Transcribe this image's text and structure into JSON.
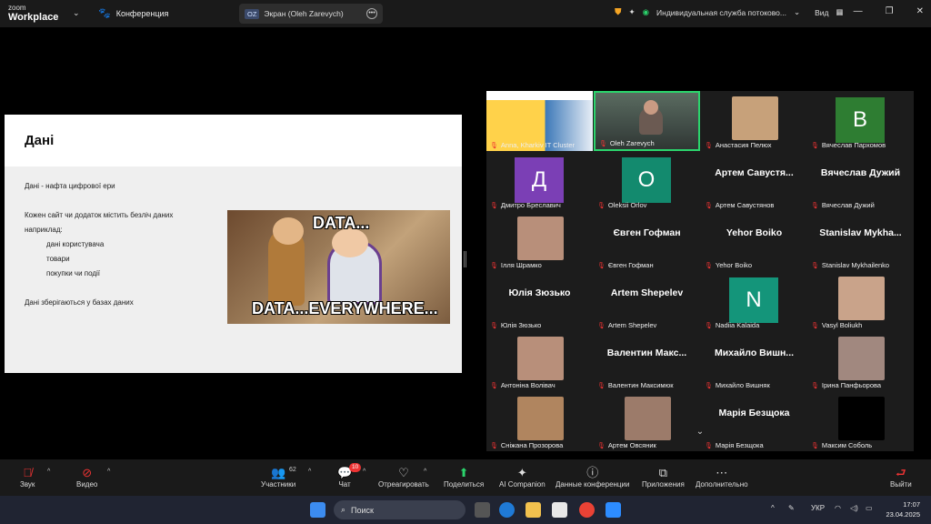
{
  "topbar": {
    "brand_line1": "zoom",
    "brand_line2": "Workplace",
    "meeting_label": "Конференция",
    "share_initials": "OZ",
    "share_label": "Экран (Oleh Zarevych)",
    "service_label": "Индивидуальная служба потоково...",
    "view_label": "Вид"
  },
  "slide": {
    "title": "Дані",
    "line1": "Дані - нафта цифрової ери",
    "line2": "Кожен сайт чи додаток містить безліч даних",
    "line3": "наприклад:",
    "item1": "дані користувача",
    "item2": "товари",
    "item3": "покупки чи події",
    "line4": "Дані зберігаються у базах даних",
    "meme_top": "DATA...",
    "meme_bottom": "DATA...EVERYWHERE..."
  },
  "participants": [
    {
      "name": "Anna, Kharkiv IT Cluster"
    },
    {
      "name": "Oleh Zarevych"
    },
    {
      "name": "Анастасия Пелюх"
    },
    {
      "name": "Вячеслав Пархомов",
      "initial": "В",
      "color": "#2e7d32"
    },
    {
      "name": "Дмитро Бреславич",
      "initial": "Д",
      "color": "#7b3fb5"
    },
    {
      "name": "Oleksii Orlov",
      "initial": "O",
      "color": "#138a6e"
    },
    {
      "name": "Артем Савустянов",
      "big": "Артем  Савустя..."
    },
    {
      "name": "Вячеслав Дужий",
      "big": "Вячеслав Дужий"
    },
    {
      "name": "Ілля Шрамко"
    },
    {
      "name": "Євген Гофман",
      "big": "Євген Гофман"
    },
    {
      "name": "Yehor Boiko",
      "big": "Yehor Boiko"
    },
    {
      "name": "Stanislav Mykhailenko",
      "big": "Stanislav  Mykha..."
    },
    {
      "name": "Юлія Зюзько",
      "big": "Юлія Зюзько"
    },
    {
      "name": "Artem Shepelev",
      "big": "Artem Shepelev"
    },
    {
      "name": "Nadiia Kalaida",
      "initial": "N",
      "color": "#14957a"
    },
    {
      "name": "Vasyl Boliukh"
    },
    {
      "name": "Антоніна Волівач"
    },
    {
      "name": "Валентин Максимюк",
      "big": "Валентин  Макс..."
    },
    {
      "name": "Михайло Вишняк",
      "big": "Михайло  Вишн..."
    },
    {
      "name": "Ірина Панфьорова"
    },
    {
      "name": "Сніжана Прозорова"
    },
    {
      "name": "Артем Овсяник"
    },
    {
      "name": "Марія Безщока",
      "big": "Марія Безщока"
    },
    {
      "name": "Максим Соболь"
    }
  ],
  "toolbar": {
    "audio": "Звук",
    "video": "Видео",
    "participants": "Участники",
    "participants_count": "62",
    "chat": "Чат",
    "chat_badge": "10",
    "react": "Отреагировать",
    "share": "Поделиться",
    "ai": "AI Companion",
    "info": "Данные конференции",
    "apps": "Приложения",
    "more": "Дополнительно",
    "leave": "Выйти"
  },
  "taskbar": {
    "search_placeholder": "Поиск",
    "lang": "УКР",
    "time": "17:07",
    "date": "23.04.2025"
  }
}
